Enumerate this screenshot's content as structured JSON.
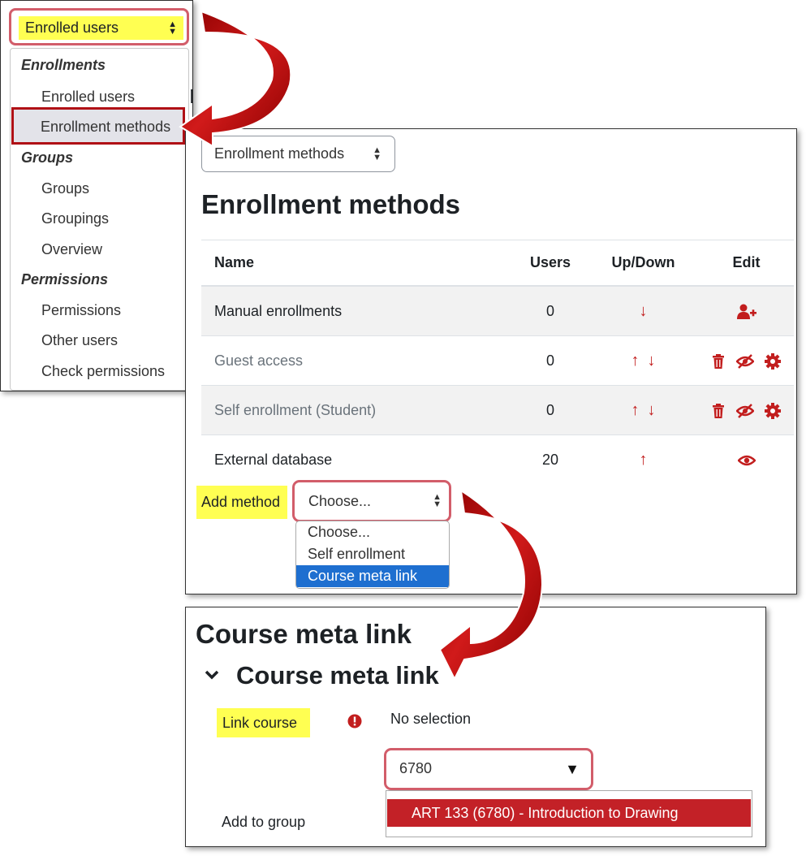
{
  "nav": {
    "select_value": "Enrolled users",
    "groups": [
      {
        "label": "Enrollments",
        "items": [
          "Enrolled users",
          "Enrollment methods"
        ]
      },
      {
        "label": "Groups",
        "items": [
          "Groups",
          "Groupings",
          "Overview"
        ]
      },
      {
        "label": "Permissions",
        "items": [
          "Permissions",
          "Other users",
          "Check permissions"
        ]
      }
    ],
    "selected_item": "Enrollment methods",
    "ghost_heading_char": "r",
    "ghost_text_char": "e"
  },
  "methods": {
    "select_value": "Enrollment methods",
    "title": "Enrollment methods",
    "columns": [
      "Name",
      "Users",
      "Up/Down",
      "Edit"
    ],
    "rows": [
      {
        "name": "Manual enrollments",
        "users": "0",
        "up": false,
        "down": true,
        "edit": [
          "enrol-users-icon"
        ],
        "enabled": true
      },
      {
        "name": "Guest access",
        "users": "0",
        "up": true,
        "down": true,
        "edit": [
          "delete-icon",
          "hide-icon",
          "settings-icon"
        ],
        "enabled": false
      },
      {
        "name": "Self enrollment (Student)",
        "users": "0",
        "up": true,
        "down": true,
        "edit": [
          "delete-icon",
          "hide-icon",
          "settings-icon"
        ],
        "enabled": false
      },
      {
        "name": "External database",
        "users": "20",
        "up": true,
        "down": false,
        "edit": [
          "show-icon"
        ],
        "enabled": true
      }
    ],
    "add_method_label": "Add method",
    "add_method_value": "Choose...",
    "add_method_options": [
      "Choose...",
      "Self enrollment",
      "Course meta link"
    ],
    "add_method_selected": "Course meta link"
  },
  "meta": {
    "title": "Course meta link",
    "section_title": "Course meta link",
    "link_course_label": "Link course",
    "no_selection": "No selection",
    "search_value": "6780",
    "suggestion": "ART 133 (6780) - Introduction to Drawing",
    "add_to_group_label": "Add to group"
  },
  "colors": {
    "highlight": "#ffff52",
    "accent_red": "#c21e1e",
    "callout_border": "#d25d6a",
    "selected_blue": "#1e6fd0"
  }
}
